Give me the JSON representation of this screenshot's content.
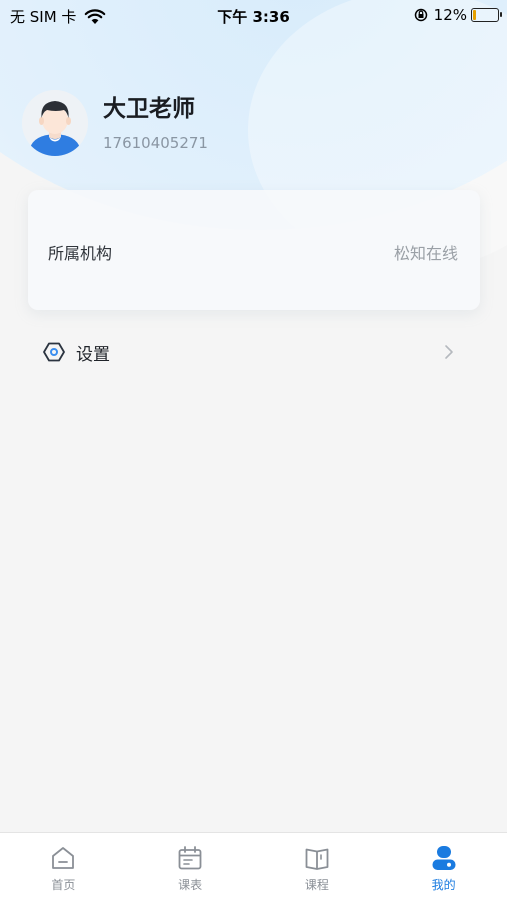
{
  "status_bar": {
    "carrier": "无 SIM 卡",
    "time": "下午 3:36",
    "battery": "12%"
  },
  "profile": {
    "name": "大卫老师",
    "phone": "17610405271"
  },
  "institution": {
    "label": "所属机构",
    "value": "松知在线"
  },
  "settings": {
    "label": "设置"
  },
  "tabs": [
    {
      "label": "首页",
      "icon": "home-icon",
      "active": false
    },
    {
      "label": "课表",
      "icon": "calendar-icon",
      "active": false
    },
    {
      "label": "课程",
      "icon": "book-icon",
      "active": false
    },
    {
      "label": "我的",
      "icon": "profile-icon",
      "active": true
    }
  ],
  "colors": {
    "accent": "#1a7be0",
    "tab_inactive": "#8a8f96",
    "background": "#f5f5f5",
    "header_tint": "#d8ecfb"
  }
}
